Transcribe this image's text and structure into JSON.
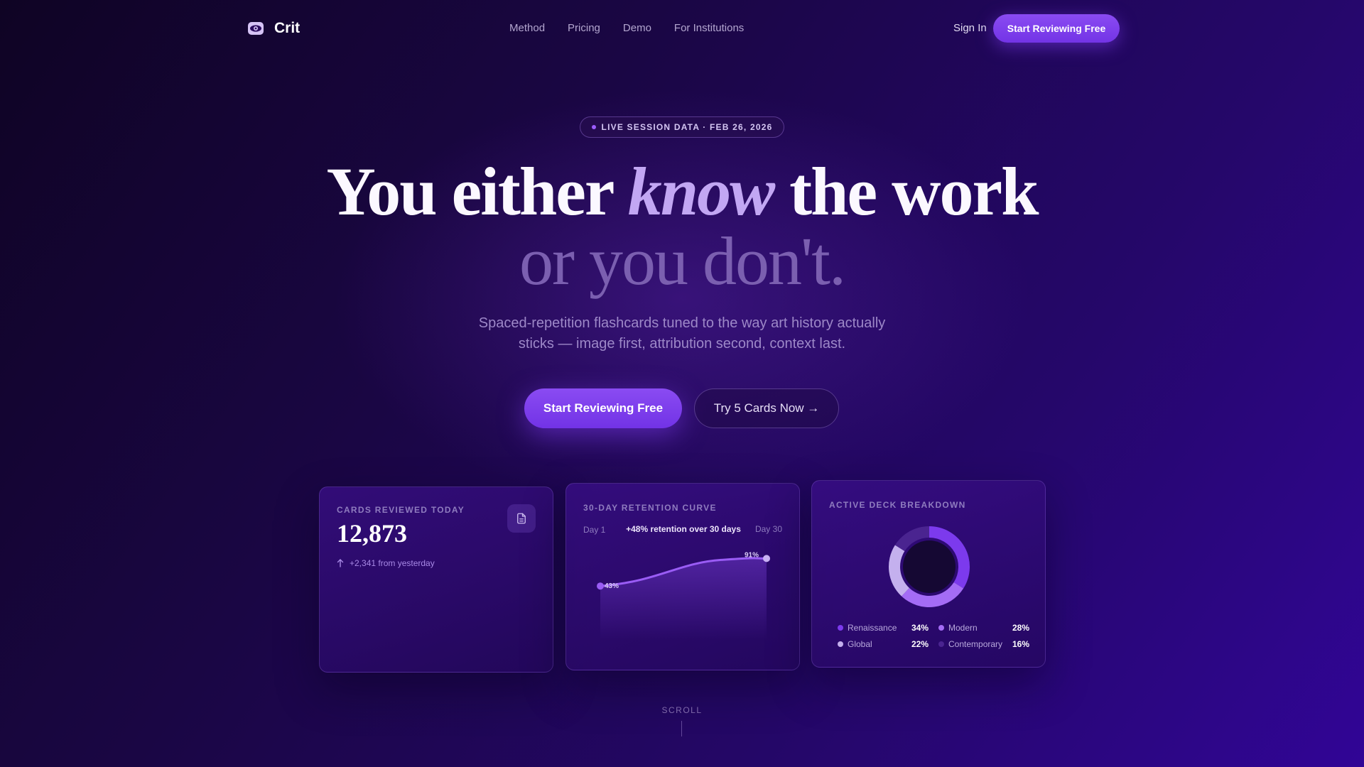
{
  "nav": {
    "brand": "Crit",
    "links": [
      "Method",
      "Pricing",
      "Demo",
      "For Institutions"
    ],
    "sign_in": "Sign In",
    "cta": "Start Reviewing Free"
  },
  "hero": {
    "badge": "LIVE SESSION DATA · FEB 26, 2026",
    "headline_before": "You either ",
    "headline_emphasis": "know",
    "headline_after": " the work",
    "headline_line2": "or you don't.",
    "subtitle": "Spaced-repetition flashcards tuned to the way art history actually sticks — image first, attribution second, context last.",
    "primary_cta": "Start Reviewing Free",
    "secondary_cta": "Try 5 Cards Now →"
  },
  "stats_card": {
    "label": "CARDS REVIEWED TODAY",
    "value": "12,873",
    "delta": "+2,341 from yesterday",
    "icon": "document-icon"
  },
  "retention_card": {
    "label": "30-DAY RETENTION CURVE",
    "start_label": "Day 1",
    "summary": "+48% retention over 30 days",
    "end_label": "Day 30"
  },
  "deck_card": {
    "label": "ACTIVE DECK BREAKDOWN"
  },
  "chart_data": [
    {
      "type": "line",
      "title": "30-DAY RETENTION CURVE",
      "x": [
        1,
        30
      ],
      "series": [
        {
          "values": [
            43,
            91
          ]
        }
      ],
      "data_labels": [
        "43%",
        "91%"
      ],
      "ylim": [
        0,
        100
      ],
      "grid": false,
      "color": "#9a5cf5"
    },
    {
      "type": "pie",
      "title": "ACTIVE DECK BREAKDOWN",
      "categories": [
        "Renaissance",
        "Modern",
        "Global",
        "Contemporary"
      ],
      "values": [
        34,
        28,
        22,
        16
      ],
      "value_labels": [
        "34%",
        "28%",
        "22%",
        "16%"
      ],
      "colors": [
        "#7c3aed",
        "#a46cf5",
        "#c4b0ee",
        "#4a2490"
      ],
      "legend": "bottom"
    }
  ],
  "scroll_hint": "SCROLL",
  "colors": {
    "accent": "#7c3aed",
    "background_dark": "#0f0424",
    "background_light": "#310596"
  }
}
